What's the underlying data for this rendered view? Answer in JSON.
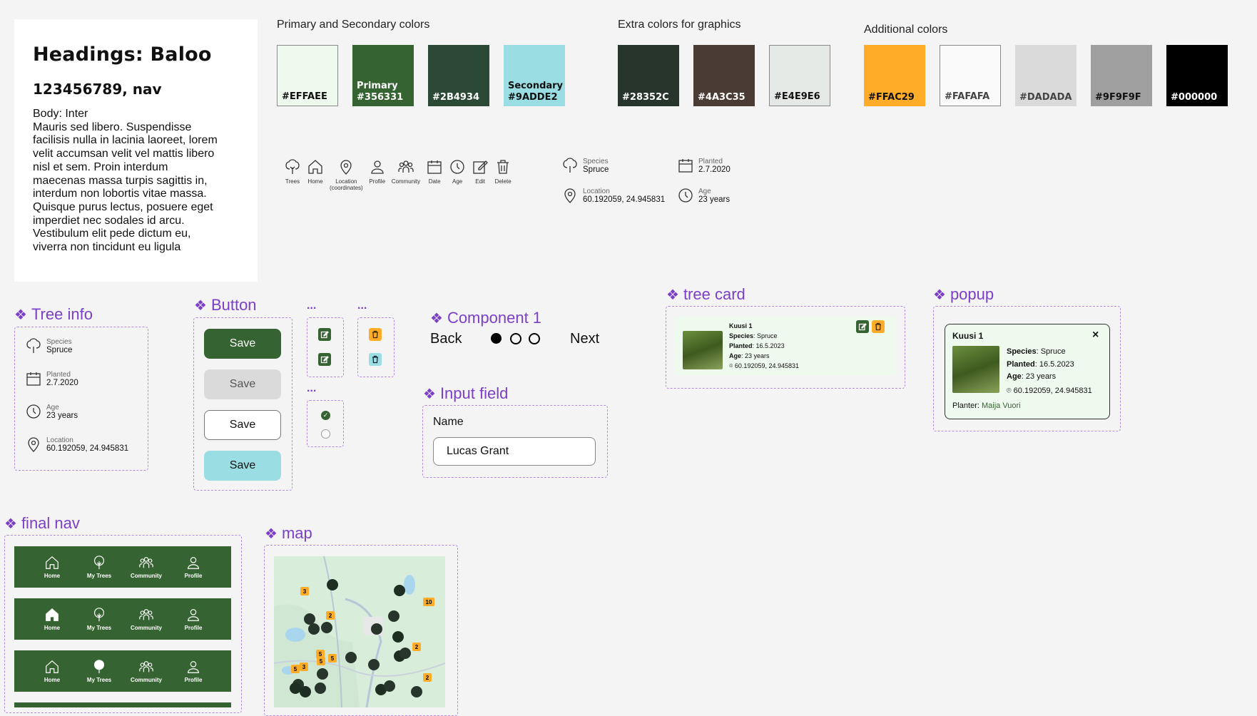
{
  "typography": {
    "heading": "Headings: Baloo",
    "subheading": "123456789, nav",
    "body_label": "Body: Inter",
    "body_text": "Mauris sed libero. Suspendisse facilisis nulla in lacinia laoreet, lorem velit accumsan velit vel mattis libero nisl et sem. Proin interdum maecenas massa turpis sagittis in, interdum non lobortis vitae massa. Quisque purus lectus, posuere eget imperdiet nec sodales id arcu. Vestibulum elit pede dictum eu, viverra non tincidunt eu ligula"
  },
  "palettes": {
    "primary_title": "Primary and Secondary colors",
    "primary": [
      {
        "label": "#EFFAEE",
        "color": "#EFFAEE",
        "text_color": "#111111"
      },
      {
        "label": "Primary\n#356331",
        "color": "#356331",
        "text_color": "#ffffff"
      },
      {
        "label": "#2B4934",
        "color": "#2B4934",
        "text_color": "#ffffff"
      },
      {
        "label": "Secondary\n#9ADDE2",
        "color": "#9ADDE2",
        "text_color": "#111111"
      }
    ],
    "extra_title": "Extra colors for graphics",
    "extra": [
      {
        "label": "#28352C",
        "color": "#28352C",
        "text_color": "#ffffff"
      },
      {
        "label": "#4A3C35",
        "color": "#4A3C35",
        "text_color": "#ffffff"
      },
      {
        "label": "#E4E9E6",
        "color": "#E4E9E6",
        "text_color": "#111111"
      }
    ],
    "additional_title": "Additional colors",
    "additional": [
      {
        "label": "#FFAC29",
        "color": "#FFAC29",
        "text_color": "#111111"
      },
      {
        "label": "#FAFAFA",
        "color": "#FAFAFA",
        "text_color": "#444444"
      },
      {
        "label": "#DADADA",
        "color": "#DADADA",
        "text_color": "#444444"
      },
      {
        "label": "#9F9F9F",
        "color": "#9F9F9F",
        "text_color": "#111111"
      },
      {
        "label": "#000000",
        "color": "#000000",
        "text_color": "#ffffff"
      }
    ]
  },
  "icons": [
    {
      "name": "tree-icon",
      "label": "Trees"
    },
    {
      "name": "home-icon",
      "label": "Home"
    },
    {
      "name": "location-icon",
      "label": "Location\n(coordinates)"
    },
    {
      "name": "profile-icon",
      "label": "Profile"
    },
    {
      "name": "community-icon",
      "label": "Community"
    },
    {
      "name": "date-icon",
      "label": "Date"
    },
    {
      "name": "age-icon",
      "label": "Age"
    },
    {
      "name": "edit-icon",
      "label": "Edit"
    },
    {
      "name": "delete-icon",
      "label": "Delete"
    }
  ],
  "info_sample": {
    "species_label": "Species",
    "species": "Spruce",
    "planted_label": "Planted",
    "planted": "2.7.2020",
    "location_label": "Location",
    "location": "60.192059, 24.945831",
    "age_label": "Age",
    "age": "23 years"
  },
  "components": {
    "tree_info": "Tree info",
    "button": "Button",
    "dots": "...",
    "component1": "Component 1",
    "input_field": "Input field",
    "tree_card": "tree card",
    "popup": "popup",
    "final_nav": "final nav",
    "map": "map"
  },
  "buttons": {
    "label": "Save"
  },
  "stepper": {
    "back": "Back",
    "next": "Next"
  },
  "input": {
    "label": "Name",
    "value": "Lucas Grant"
  },
  "card": {
    "name": "Kuusi 1",
    "species_label": "Species",
    "species": "Spruce",
    "planted_label": "Planted",
    "planted": "16.5.2023",
    "age_label": "Age",
    "age": "23 years",
    "location": "60.192059, 24.945831",
    "planter_label": "Planter:",
    "planter": "Maija Vuori",
    "close": "×"
  },
  "nav": {
    "home": "Home",
    "my_trees": "My Trees",
    "community": "Community",
    "profile": "Profile"
  },
  "map_counts": [
    "3",
    "2",
    "10",
    "5",
    "5",
    "5",
    "5",
    "3",
    "2",
    "2"
  ]
}
